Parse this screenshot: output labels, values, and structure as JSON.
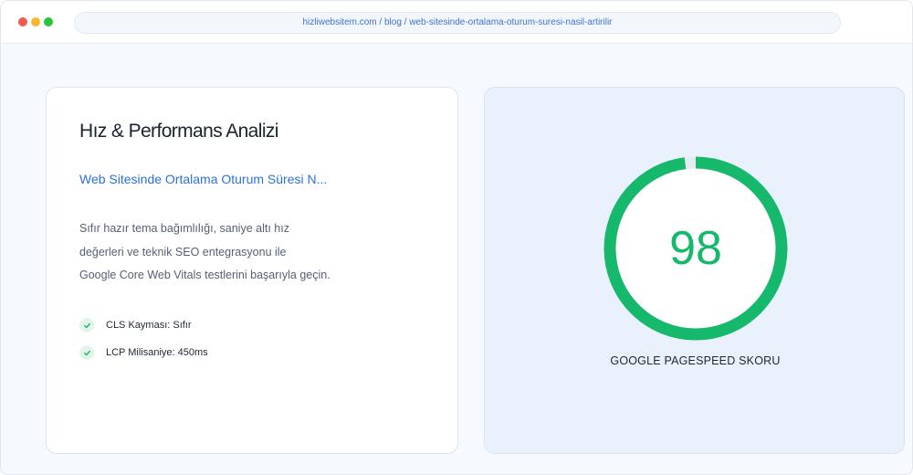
{
  "browser": {
    "url": "hizliwebsitem.com / blog / web-sitesinde-ortalama-oturum-suresi-nasil-artirilir",
    "dots": [
      "#f25b52",
      "#f7b731",
      "#27c43f"
    ]
  },
  "analysis": {
    "title": "Hız & Performans Analizi",
    "post_title": "Web Sitesinde Ortalama Oturum Süresi N...",
    "description_lines": [
      "Sıfır hazır tema bağımlılığı, saniye altı hız",
      "değerleri ve teknik SEO entegrasyonu ile",
      "Google Core Web Vitals testlerini başarıyla geçin."
    ],
    "checks": [
      {
        "label": "CLS Kayması: Sıfır",
        "icon": "check-icon"
      },
      {
        "label": "LCP Milisaniye: 450ms",
        "icon": "check-icon"
      }
    ]
  },
  "score": {
    "value": "98",
    "percent": 98,
    "label": "GOOGLE PAGESPEED SKORU",
    "color": "#16b96b"
  },
  "colors": {
    "accent": "#2a72d8",
    "success": "#16b96b",
    "check_bg": "#e3f4ea"
  }
}
